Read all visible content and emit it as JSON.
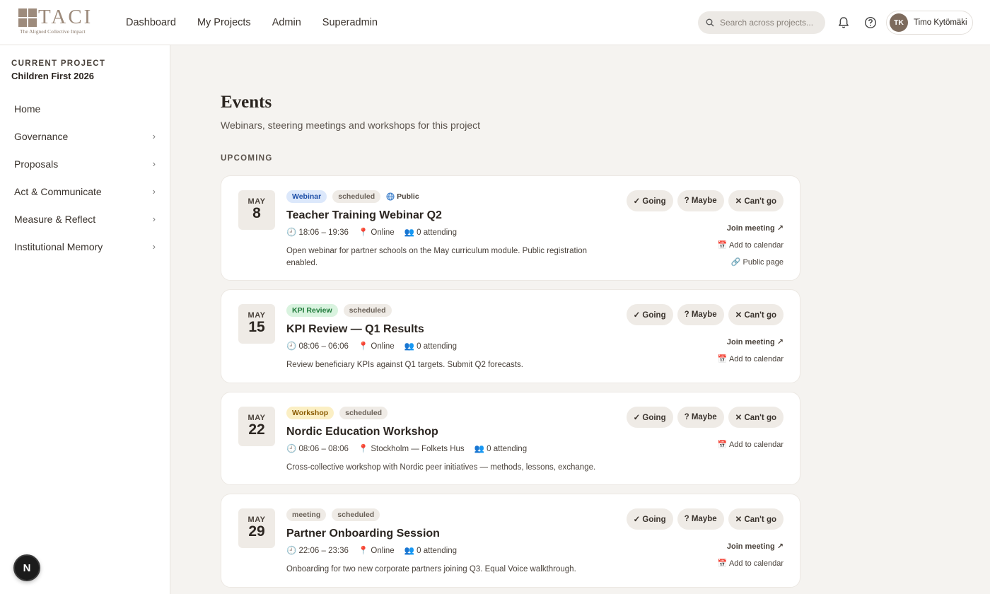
{
  "brand": {
    "word": "TACI",
    "tagline": "The Aligned Collective Impact"
  },
  "nav": [
    {
      "label": "Dashboard"
    },
    {
      "label": "My Projects"
    },
    {
      "label": "Admin"
    },
    {
      "label": "Superadmin"
    }
  ],
  "search": {
    "placeholder": "Search across projects..."
  },
  "user": {
    "initials": "TK",
    "name": "Timo Kytömäki"
  },
  "sidebar": {
    "project_label": "CURRENT PROJECT",
    "project_name": "Children First 2026",
    "items": [
      {
        "label": "Home",
        "has_children": false
      },
      {
        "label": "Governance",
        "has_children": true
      },
      {
        "label": "Proposals",
        "has_children": true
      },
      {
        "label": "Act & Communicate",
        "has_children": true
      },
      {
        "label": "Measure & Reflect",
        "has_children": true
      },
      {
        "label": "Institutional Memory",
        "has_children": true
      }
    ],
    "chevron": "›"
  },
  "floating_badge": "N",
  "main": {
    "title": "Events",
    "subtitle": "Webinars, steering meetings and workshops for this project",
    "section": "UPCOMING"
  },
  "rsvp": {
    "going": "✓ Going",
    "maybe": "? Maybe",
    "cant": "✕ Can't go"
  },
  "links": {
    "join": "Join meeting ↗",
    "calendar": "📅 Add to calendar",
    "public_page": "🔗 Public page"
  },
  "events": [
    {
      "month": "MAY",
      "day": "8",
      "type": "Webinar",
      "type_bg": "#dce8fb",
      "type_fg": "#1d4fa8",
      "status": "scheduled",
      "public": "Public",
      "title": "Teacher Training Webinar Q2",
      "time": "🕘 18:06 – 19:36",
      "location": "📍 Online",
      "attending": "👥 0 attending",
      "description": "Open webinar for partner schools on the May curriculum module. Public registration enabled.",
      "has_join": true,
      "has_public": true
    },
    {
      "month": "MAY",
      "day": "15",
      "type": "KPI Review",
      "type_bg": "#d9f3df",
      "type_fg": "#1f7a3a",
      "status": "scheduled",
      "public": "",
      "title": "KPI Review — Q1 Results",
      "time": "🕘 08:06 – 06:06",
      "location": "📍 Online",
      "attending": "👥 0 attending",
      "description": "Review beneficiary KPIs against Q1 targets. Submit Q2 forecasts.",
      "has_join": true,
      "has_public": false
    },
    {
      "month": "MAY",
      "day": "22",
      "type": "Workshop",
      "type_bg": "#fbefc4",
      "type_fg": "#8a5a00",
      "status": "scheduled",
      "public": "",
      "title": "Nordic Education Workshop",
      "time": "🕘 08:06 – 08:06",
      "location": "📍 Stockholm — Folkets Hus",
      "attending": "👥 0 attending",
      "description": "Cross-collective workshop with Nordic peer initiatives — methods, lessons, exchange.",
      "has_join": false,
      "has_public": false
    },
    {
      "month": "MAY",
      "day": "29",
      "type": "meeting",
      "type_bg": "#efebe6",
      "type_fg": "#6b6259",
      "status": "scheduled",
      "public": "",
      "title": "Partner Onboarding Session",
      "time": "🕘 22:06 – 23:36",
      "location": "📍 Online",
      "attending": "👥 0 attending",
      "description": "Onboarding for two new corporate partners joining Q3. Equal Voice walkthrough.",
      "has_join": true,
      "has_public": false
    }
  ]
}
